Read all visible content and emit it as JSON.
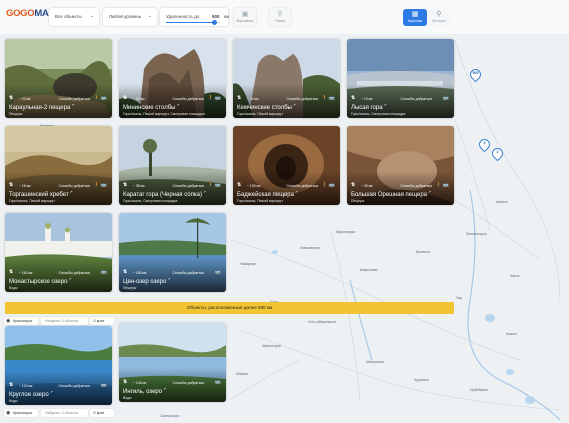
{
  "app": {
    "logo_go": "GOGO",
    "logo_map": "MAP"
  },
  "filters": {
    "objects_label": "Все объекты",
    "access_label": "Любой уровень",
    "distance_label": "Удаленность до",
    "distance_value": "500",
    "distance_unit": "км",
    "distance_fraction": 0.9,
    "icon_btn_1_label": "Мои места",
    "icon_btn_2_label": "Поиск"
  },
  "view": {
    "cards_label": "Карточки",
    "map_label": "На карте"
  },
  "colors": {
    "accent": "#2c7be5",
    "banner": "#f3c431",
    "logo_orange": "#e05a1c",
    "logo_blue": "#2a4b8d"
  },
  "cards": [
    {
      "title": "Караульная-2 пещера",
      "km": "~ 23 км",
      "how": "Способы добраться",
      "tags": "Пещеры"
    },
    {
      "title": "Мининские столбы",
      "km": "~ 30 км",
      "how": "Способы добраться",
      "tags": "Горы/скалы, Пеший маршрут, Смотровая площадка"
    },
    {
      "title": "Кемчинские столбы",
      "km": "~ 34 км",
      "how": "Способы добраться",
      "tags": "Горы/скалы, Пеший маршрут"
    },
    {
      "title": "Лысая гора",
      "km": "~ 13 км",
      "how": "Способы добраться",
      "tags": "Горы/скалы, Смотровая площадка"
    },
    {
      "title": "Торгашинский хребет",
      "km": "~ 16 км",
      "how": "Способы добраться",
      "tags": "Горы/скалы, Пеший маршрут"
    },
    {
      "title": "Каратаг гора (Черная сопка)",
      "km": "~ 38 км",
      "how": "Способы добраться",
      "tags": "Горы/скалы, Смотровая площадка"
    },
    {
      "title": "Баджейская пещера",
      "km": "~ 130 км",
      "how": "Способы добраться",
      "tags": "Горы/скалы, Пеший маршрут"
    },
    {
      "title": "Большая Орешная пещера",
      "km": "~ 40 км",
      "how": "Способы добраться",
      "tags": "Пещеры"
    },
    {
      "title": "Монастырское озеро",
      "km": "~ 160 км",
      "how": "Способы добраться",
      "tags": "Воды"
    },
    {
      "title": "Цен-озер озеро",
      "km": "~ 180 км",
      "how": "Способы добраться",
      "tags": "Пещеры"
    },
    {
      "title": "Круглое озеро",
      "km": "~ 120 км",
      "how": "Способы добраться",
      "tags": "Воды"
    },
    {
      "title": "Ингиль, озеро",
      "km": "~ 146 км",
      "how": "Способы добраться",
      "tags": "Воды"
    }
  ],
  "banner": "Объекты, расположенные далее 500 км",
  "region_rows": [
    {
      "place": "Красноярск",
      "found": "Найдено: 5 объекта",
      "about": "О крае"
    },
    {
      "place": "Красноярск",
      "found": "Найдено: 3 объекта",
      "about": "О крае"
    }
  ],
  "map": {
    "labels": [
      "Каменка",
      "Зеленогорск",
      "Ачинск",
      "Красноярск",
      "Канск",
      "Уяр",
      "Ужур",
      "Шарыпово",
      "Назарово",
      "Балахта",
      "Новоселово",
      "Усть-Абаканское",
      "Черногорск",
      "Минусинск",
      "Абакан",
      "Курагино",
      "Кызыл",
      "Саяногорск",
      "Ирбейское"
    ],
    "markers": [
      "500",
      "3",
      "2"
    ]
  }
}
